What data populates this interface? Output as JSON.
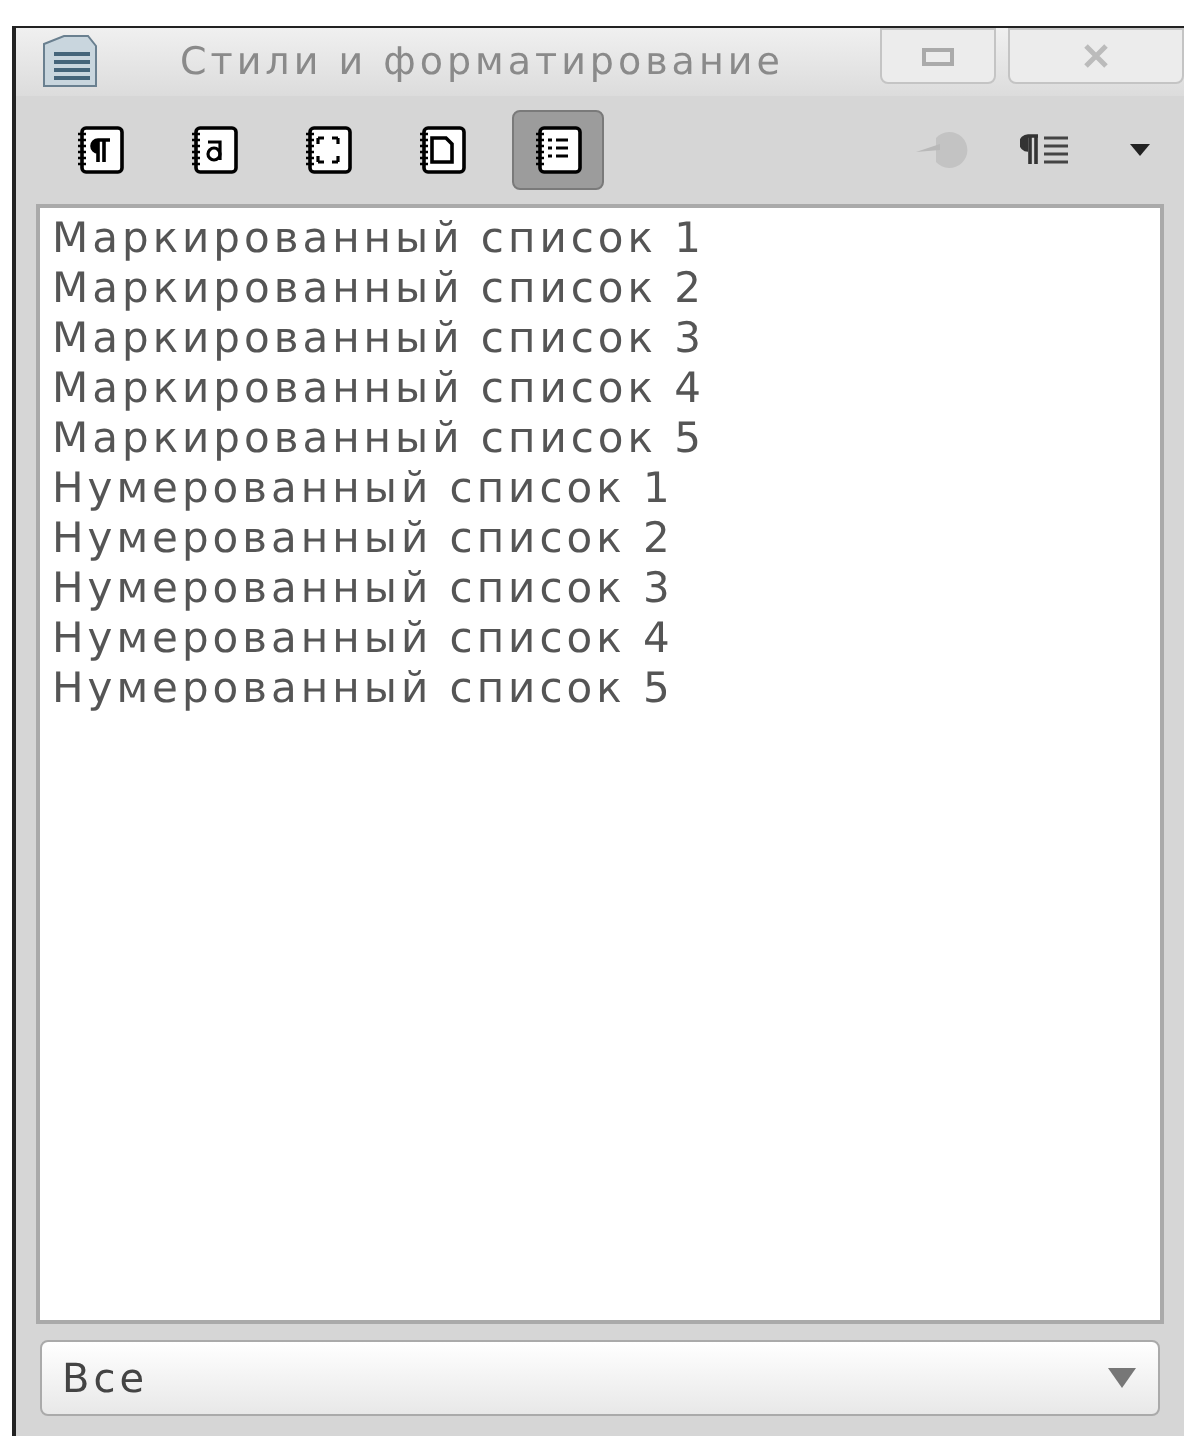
{
  "window": {
    "title": "Стили и форматирование"
  },
  "toolbar": {
    "families": [
      {
        "kind": "paragraph",
        "selected": false
      },
      {
        "kind": "character",
        "selected": false
      },
      {
        "kind": "frame",
        "selected": false
      },
      {
        "kind": "page",
        "selected": false
      },
      {
        "kind": "list",
        "selected": true
      }
    ],
    "fill_format": {
      "disabled": true
    }
  },
  "styles": [
    "Маркированный список 1",
    "Маркированный список 2",
    "Маркированный список 3",
    "Маркированный список 4",
    "Маркированный список 5",
    "Нумерованный список 1",
    "Нумерованный список 2",
    "Нумерованный список 3",
    "Нумерованный список 4",
    "Нумерованный список 5"
  ],
  "filter": {
    "value": "Все"
  }
}
